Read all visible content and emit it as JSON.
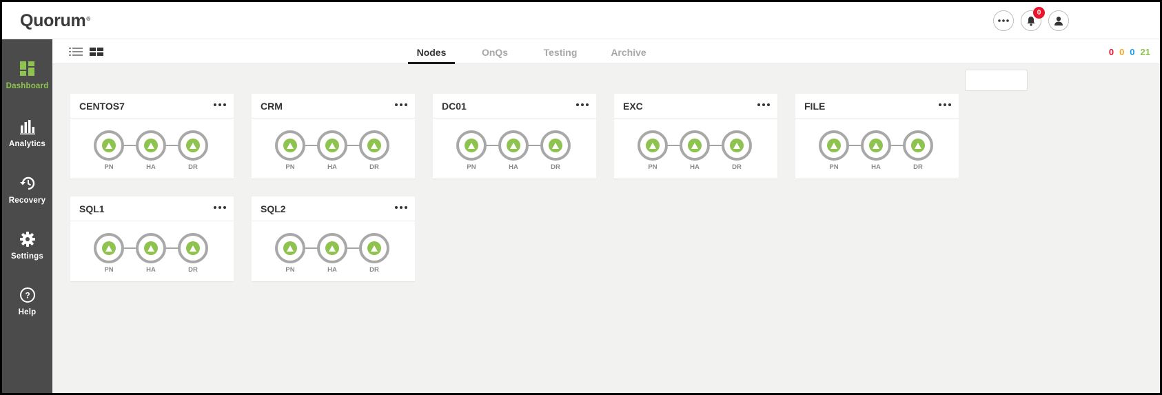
{
  "app": {
    "logo_text": "Quorum",
    "logo_mark": "®",
    "notification_count": "0"
  },
  "sidebar": {
    "items": [
      {
        "label": "Dashboard",
        "icon": "dashboard-icon",
        "active": true
      },
      {
        "label": "Analytics",
        "icon": "bar-chart-icon",
        "active": false
      },
      {
        "label": "Recovery",
        "icon": "history-icon",
        "active": false
      },
      {
        "label": "Settings",
        "icon": "gear-icon",
        "active": false
      },
      {
        "label": "Help",
        "icon": "help-icon",
        "active": false
      }
    ]
  },
  "tabs": [
    {
      "label": "Nodes",
      "active": true
    },
    {
      "label": "OnQs",
      "active": false
    },
    {
      "label": "Testing",
      "active": false
    },
    {
      "label": "Archive",
      "active": false
    }
  ],
  "status_counts": [
    {
      "value": "0",
      "color": "#e8142b"
    },
    {
      "value": "0",
      "color": "#f5a623"
    },
    {
      "value": "0",
      "color": "#1ba1e2"
    },
    {
      "value": "21",
      "color": "#8fc34f"
    }
  ],
  "colors": {
    "accent_green": "#8fc34f",
    "sidebar_bg": "#4b4b4b",
    "alert_red": "#e8142b"
  },
  "node_labels": [
    "PN",
    "HA",
    "DR"
  ],
  "cards": [
    {
      "title": "CENTOS7"
    },
    {
      "title": "CRM"
    },
    {
      "title": "DC01"
    },
    {
      "title": "EXC"
    },
    {
      "title": "FILE"
    },
    {
      "title": "SQL1"
    },
    {
      "title": "SQL2"
    }
  ]
}
